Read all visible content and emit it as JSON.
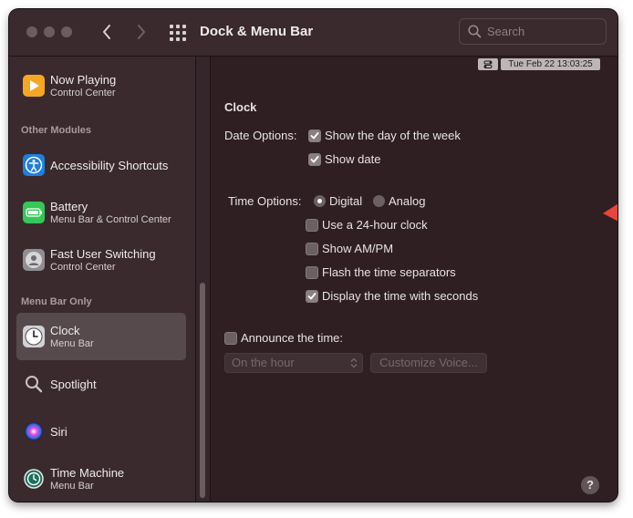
{
  "window": {
    "title": "Dock & Menu Bar",
    "search_placeholder": "Search"
  },
  "sidebar": {
    "items": [
      {
        "label": "Now Playing",
        "sub": "Control Center",
        "icon": "now-playing-icon"
      },
      {
        "label": "Accessibility Shortcuts",
        "sub": "",
        "icon": "accessibility-icon"
      },
      {
        "label": "Battery",
        "sub": "Menu Bar & Control Center",
        "icon": "battery-icon"
      },
      {
        "label": "Fast User Switching",
        "sub": "Control Center",
        "icon": "user-switching-icon"
      },
      {
        "label": "Clock",
        "sub": "Menu Bar",
        "icon": "clock-icon",
        "selected": true
      },
      {
        "label": "Spotlight",
        "sub": "",
        "icon": "spotlight-icon"
      },
      {
        "label": "Siri",
        "sub": "",
        "icon": "siri-icon"
      },
      {
        "label": "Time Machine",
        "sub": "Menu Bar",
        "icon": "time-machine-icon"
      }
    ],
    "sections": {
      "other_modules": "Other Modules",
      "menu_bar_only": "Menu Bar Only"
    }
  },
  "menubar_preview": {
    "datetime": "Tue Feb 22  13:03:25",
    "icon": "control-center-icon"
  },
  "clock": {
    "heading": "Clock",
    "date_options_label": "Date Options:",
    "show_day_of_week": {
      "label": "Show the day of the week",
      "checked": true
    },
    "show_date": {
      "label": "Show date",
      "checked": true
    },
    "time_options_label": "Time Options:",
    "digital": {
      "label": "Digital",
      "selected": true
    },
    "analog": {
      "label": "Analog",
      "selected": false
    },
    "use_24_hour": {
      "label": "Use a 24-hour clock",
      "checked": false
    },
    "show_am_pm": {
      "label": "Show AM/PM",
      "checked": false
    },
    "flash_separators": {
      "label": "Flash the time separators",
      "checked": false
    },
    "display_seconds": {
      "label": "Display the time with seconds",
      "checked": true
    },
    "announce_time": {
      "label": "Announce the time:",
      "checked": false
    },
    "announce_interval": "On the hour",
    "customize_voice": "Customize Voice..."
  },
  "help_label": "?",
  "colors": {
    "window_bg": "#2f1f22",
    "sidebar_bg": "#3a2a2d",
    "selected_bg": "#574a4c",
    "arrow": "#e8453c"
  }
}
